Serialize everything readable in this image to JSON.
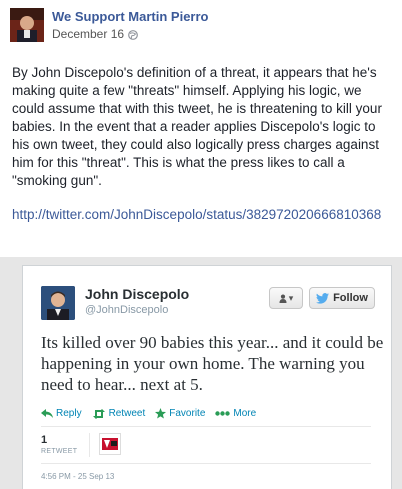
{
  "facebook_post": {
    "page_name": "We Support Martin Pierro",
    "date": "December 16",
    "privacy_icon": "globe-icon",
    "body": "By John Discepolo's definition of a threat, it appears that he's making quite a few \"threats\" himself. Applying his logic, we could assume that with this tweet, he is threatening to kill your babies. In the event that a reader applies Discepolo's logic to his own tweet, they could also logically press charges against him for this \"threat\". This is what the press likes to call a \"smoking gun\".",
    "link": "http://twitter.com/JohnDiscepolo/status/382972020666810368"
  },
  "tweet": {
    "name": "John Discepolo",
    "handle": "@JohnDiscepolo",
    "user_actions_icon": "user-dropdown-icon",
    "follow_label": "Follow",
    "text": "Its killed over 90 babies this year... and it could be happening in your own home.  The warning you need to hear... next at 5.",
    "actions": {
      "reply": "Reply",
      "retweet": "Retweet",
      "favorite": "Favorite",
      "more": "More"
    },
    "retweet_count": "1",
    "retweet_label": "RETWEET",
    "timestamp": "4:56 PM - 25 Sep 13",
    "colors": {
      "link_blue": "#0084b4",
      "facebook_blue": "#3b5998",
      "twitter_bird": "#55acee"
    }
  }
}
